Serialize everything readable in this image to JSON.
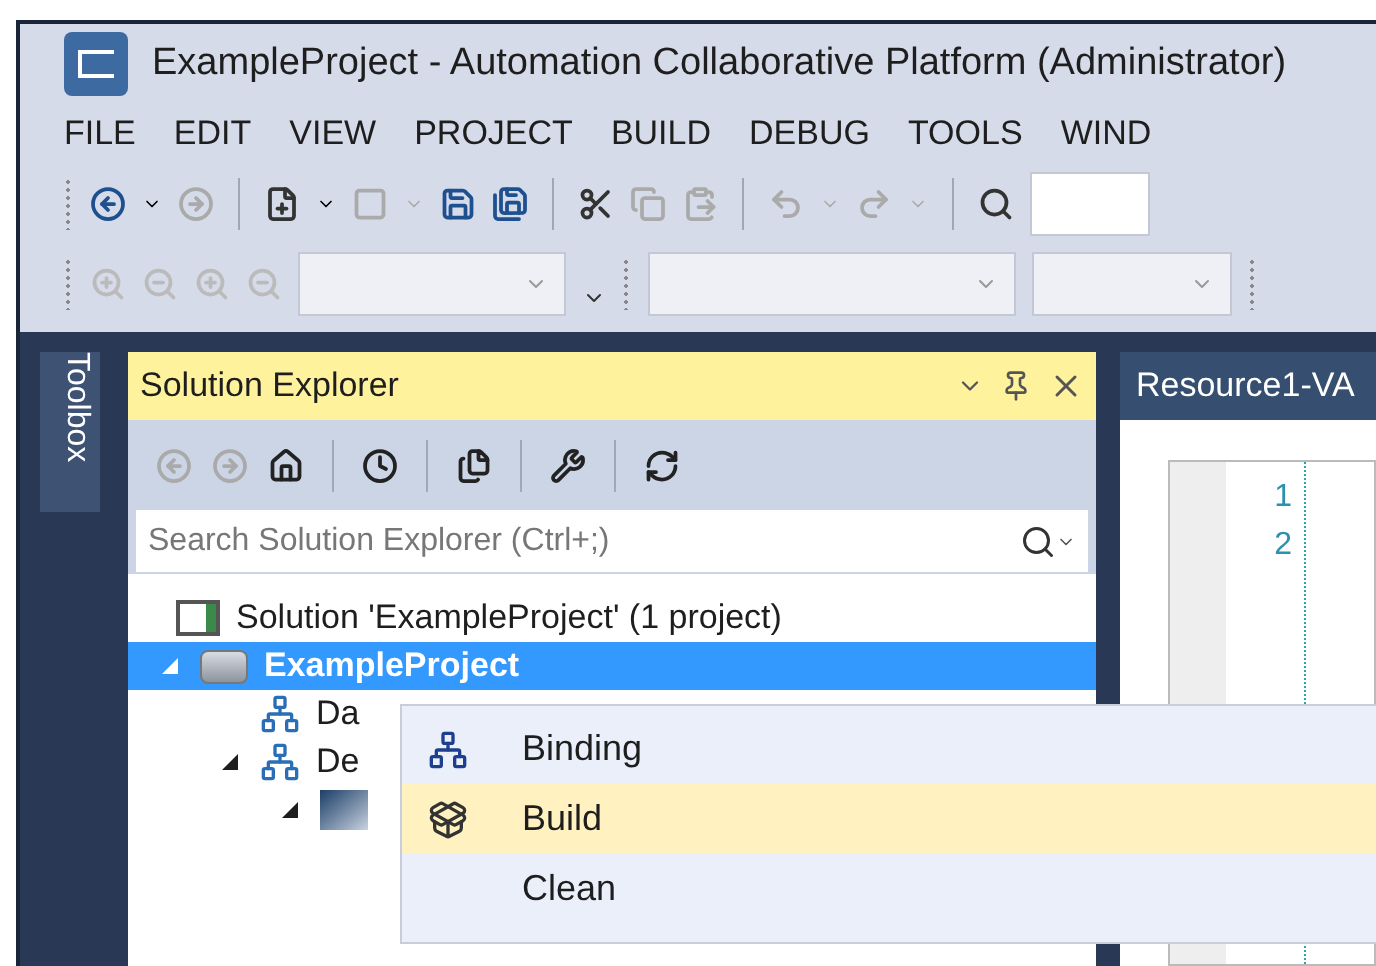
{
  "window": {
    "title": "ExampleProject - Automation Collaborative Platform (Administrator)"
  },
  "menu": [
    "FILE",
    "EDIT",
    "VIEW",
    "PROJECT",
    "BUILD",
    "DEBUG",
    "TOOLS",
    "WIND"
  ],
  "toolbox_tab": "Toolbox",
  "solution_explorer": {
    "title": "Solution Explorer",
    "search": {
      "placeholder": "Search Solution Explorer (Ctrl+;)"
    },
    "tree": [
      {
        "label": "Solution 'ExampleProject' (1 project)",
        "selected": false,
        "children": [
          {
            "label": "ExampleProject",
            "expanded": true,
            "selected": true,
            "children": [
              {
                "label": "Da",
                "selected": false
              },
              {
                "label": "De",
                "expanded": true,
                "selected": false,
                "children": [
                  {
                    "expanded": true,
                    "selected": false
                  }
                ]
              }
            ]
          }
        ]
      }
    ]
  },
  "editor": {
    "tab": "Resource1-VA",
    "line_numbers": [
      "1",
      "2"
    ]
  },
  "context_menu": [
    {
      "label": "Binding",
      "selected": false
    },
    {
      "label": "Build",
      "selected": true
    },
    {
      "label": "Clean",
      "selected": false
    }
  ]
}
